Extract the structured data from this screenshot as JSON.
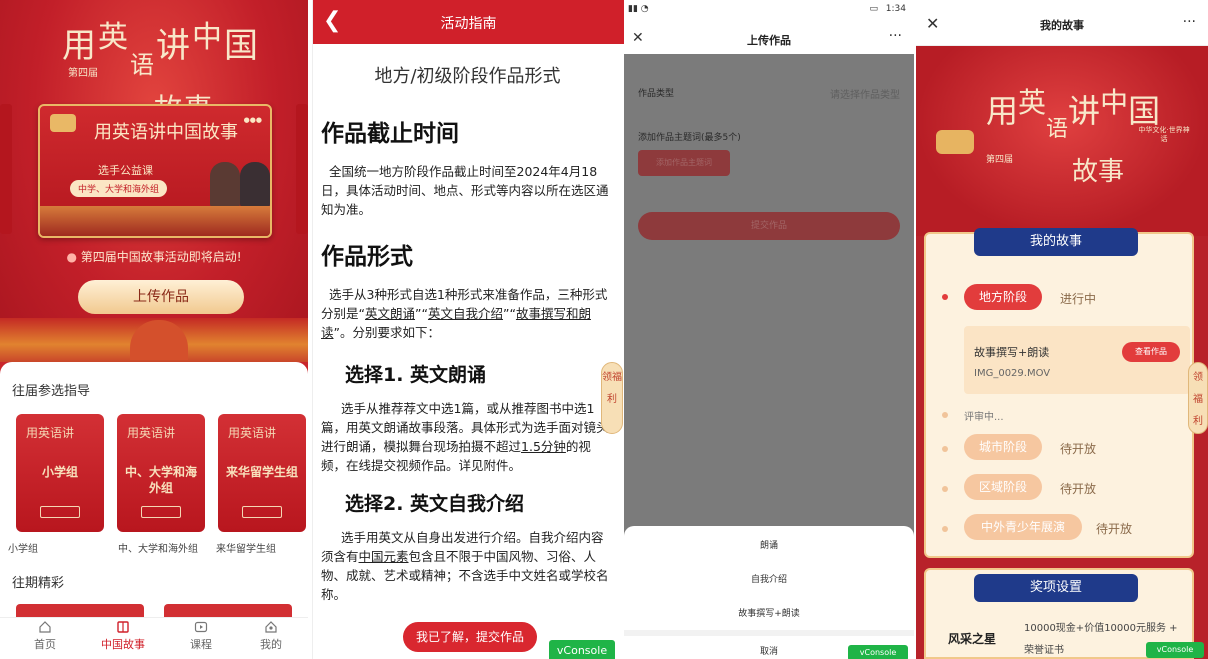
{
  "panel1": {
    "title_chars": [
      "用",
      "英",
      "语",
      "讲",
      "中",
      "国",
      "故",
      "事"
    ],
    "edition": "第四届",
    "banner": {
      "title": "用英语讲中国故事",
      "course": "选手公益课",
      "pill": "中学、大学和海外组"
    },
    "announcement": "第四届中国故事活动即将启动!",
    "upload_button": "上传作品",
    "section_guide": "往届参选指导",
    "guide_cards": [
      {
        "label": "小学组",
        "card_text": "小学组"
      },
      {
        "label": "中、大学和海外组",
        "card_text": "中、大学和海外组"
      },
      {
        "label": "来华留学生组",
        "card_text": "来华留学生组"
      }
    ],
    "section_highlights": "往期精彩",
    "tabs": [
      {
        "label": "首页",
        "icon": "home-icon"
      },
      {
        "label": "中国故事",
        "icon": "book-icon"
      },
      {
        "label": "课程",
        "icon": "play-icon"
      },
      {
        "label": "我的",
        "icon": "user-icon"
      }
    ],
    "colors": {
      "primary": "#c9262c",
      "gold": "#f1c98f",
      "active_tab": "#d0202a"
    }
  },
  "panel2": {
    "nav_title": "活动指南",
    "back_icon": "chevron-left-icon",
    "subtitle": "地方/初级阶段作品形式",
    "deadline_heading": "作品截止时间",
    "deadline_text": "全国统一地方阶段作品截止时间至2024年4月18日，具体活动时间、地点、形式等内容以所在选区通知为准。",
    "form_heading": "作品形式",
    "form_intro_a": "选手从3种形式自选1种形式来准备作品，三种形式分别是",
    "form_opt1": "英文朗诵",
    "form_opt2": "英文自我介绍",
    "form_opt3": "故事撰写和朗读",
    "form_intro_b": "。分别要求如下：",
    "choice1_heading": "选择1. 英文朗诵",
    "choice1_text_a": "选手从推荐荐文中选1篇，或从推荐图书中选1篇，用英文朗诵故事段落。具体形式为选手面对镜头进行朗诵，模拟舞台现场拍摄不超过",
    "choice1_link": "1.5分钟",
    "choice1_text_b": "的视频，在线提交视频作品。详见附件。",
    "choice2_heading": "选择2. 英文自我介绍",
    "choice2_text_a": "选手用英文从自身出发进行介绍。自我介绍内容须含有",
    "choice2_link": "中国元素",
    "choice2_text_b": "包含且不限于中国风物、习俗、人物、成就、艺术或精神；不含选手中文姓名或学校名称。",
    "fu_badge": "领福利",
    "confirm_button": "我已了解，提交作品",
    "vconsole": "vConsole"
  },
  "panel3": {
    "time": "1:34",
    "header_title": "上传作品",
    "close_icon": "close-icon",
    "more_icon": "more-icon",
    "type_label": "作品类型",
    "type_placeholder": "请选择作品类型",
    "topic_label": "添加作品主题词(最多5个)",
    "add_topic_button": "添加作品主题词",
    "submit_button": "提交作品",
    "sheet_options": [
      "朗诵",
      "自我介绍",
      "故事撰写+朗读"
    ],
    "cancel": "取消",
    "vconsole": "vConsole"
  },
  "panel4": {
    "header_title": "我的故事",
    "title_chars": [
      "用",
      "英",
      "语",
      "讲",
      "中",
      "国",
      "故",
      "事"
    ],
    "edition": "第四届",
    "badge_right": "中华文化·世界神话",
    "my_story_title": "我的故事",
    "stage_local": "地方阶段",
    "status_in_progress": "进行中",
    "work_title": "故事撰写+朗读",
    "view_button": "查看作品",
    "work_file": "IMG_0029.MOV",
    "reviewing": "评审中...",
    "stage_city": "城市阶段",
    "stage_region": "区域阶段",
    "stage_youth": "中外青少年展演",
    "status_pending": "待开放",
    "fu_badge": "领福利",
    "awards_title": "奖项设置",
    "award_name": "风采之星",
    "award_desc": "10000现金+价值10000元服务 + 荣誉证书",
    "vconsole": "vConsole"
  }
}
